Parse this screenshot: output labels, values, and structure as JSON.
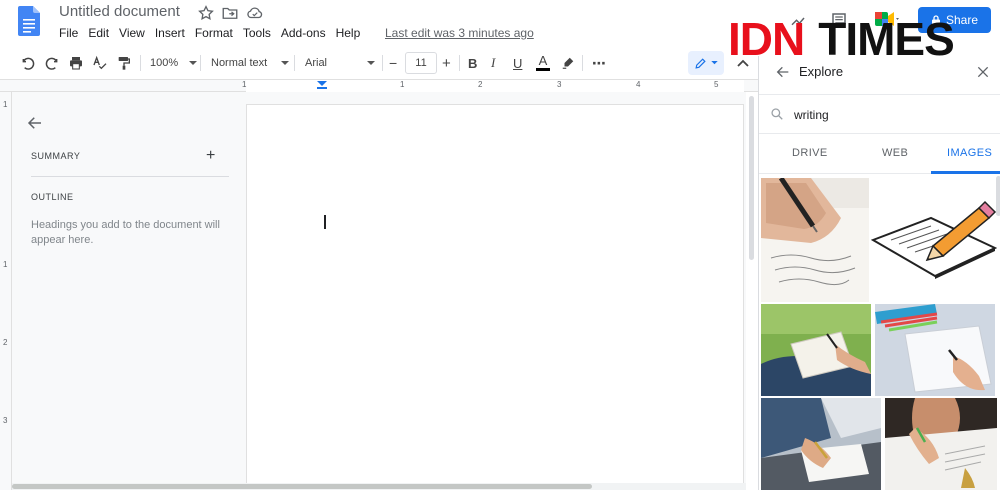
{
  "document": {
    "title": "Untitled document",
    "last_edit": "Last edit was 3 minutes ago"
  },
  "menu": [
    "File",
    "Edit",
    "View",
    "Insert",
    "Format",
    "Tools",
    "Add-ons",
    "Help"
  ],
  "share": {
    "label": "Share"
  },
  "watermark": {
    "part1": "IDN",
    "part2": "TIMES"
  },
  "toolbar": {
    "zoom": "100%",
    "style": "Normal text",
    "font": "Arial",
    "font_size": "11",
    "bold": "B",
    "italic": "I",
    "underline": "U",
    "text_color_glyph": "A",
    "more": "⋯"
  },
  "ruler": {
    "marks": [
      "1",
      "1",
      "1",
      "2",
      "3",
      "4",
      "5"
    ]
  },
  "vertical_ruler": {
    "marks": [
      "1",
      "1",
      "2",
      "3"
    ]
  },
  "outline": {
    "summary": "SUMMARY",
    "summary_add": "+",
    "outline": "OUTLINE",
    "hint": "Headings you add to the document will appear here."
  },
  "explore": {
    "title": "Explore",
    "search_value": "writing",
    "tabs": [
      {
        "label": "DRIVE",
        "active": false
      },
      {
        "label": "WEB",
        "active": false
      },
      {
        "label": "IMAGES",
        "active": true
      }
    ]
  },
  "icons": {
    "docs_logo": "docs-logo-icon",
    "star": "star-icon",
    "move": "folder-move-icon",
    "cloud": "cloud-status-icon",
    "trend": "trending-icon",
    "comment": "comment-icon",
    "meet": "meet-icon",
    "lock": "lock-icon"
  },
  "colors": {
    "accent": "#1a73e8",
    "watermark_red": "#e8101c",
    "text_color_bar": "#000000"
  }
}
